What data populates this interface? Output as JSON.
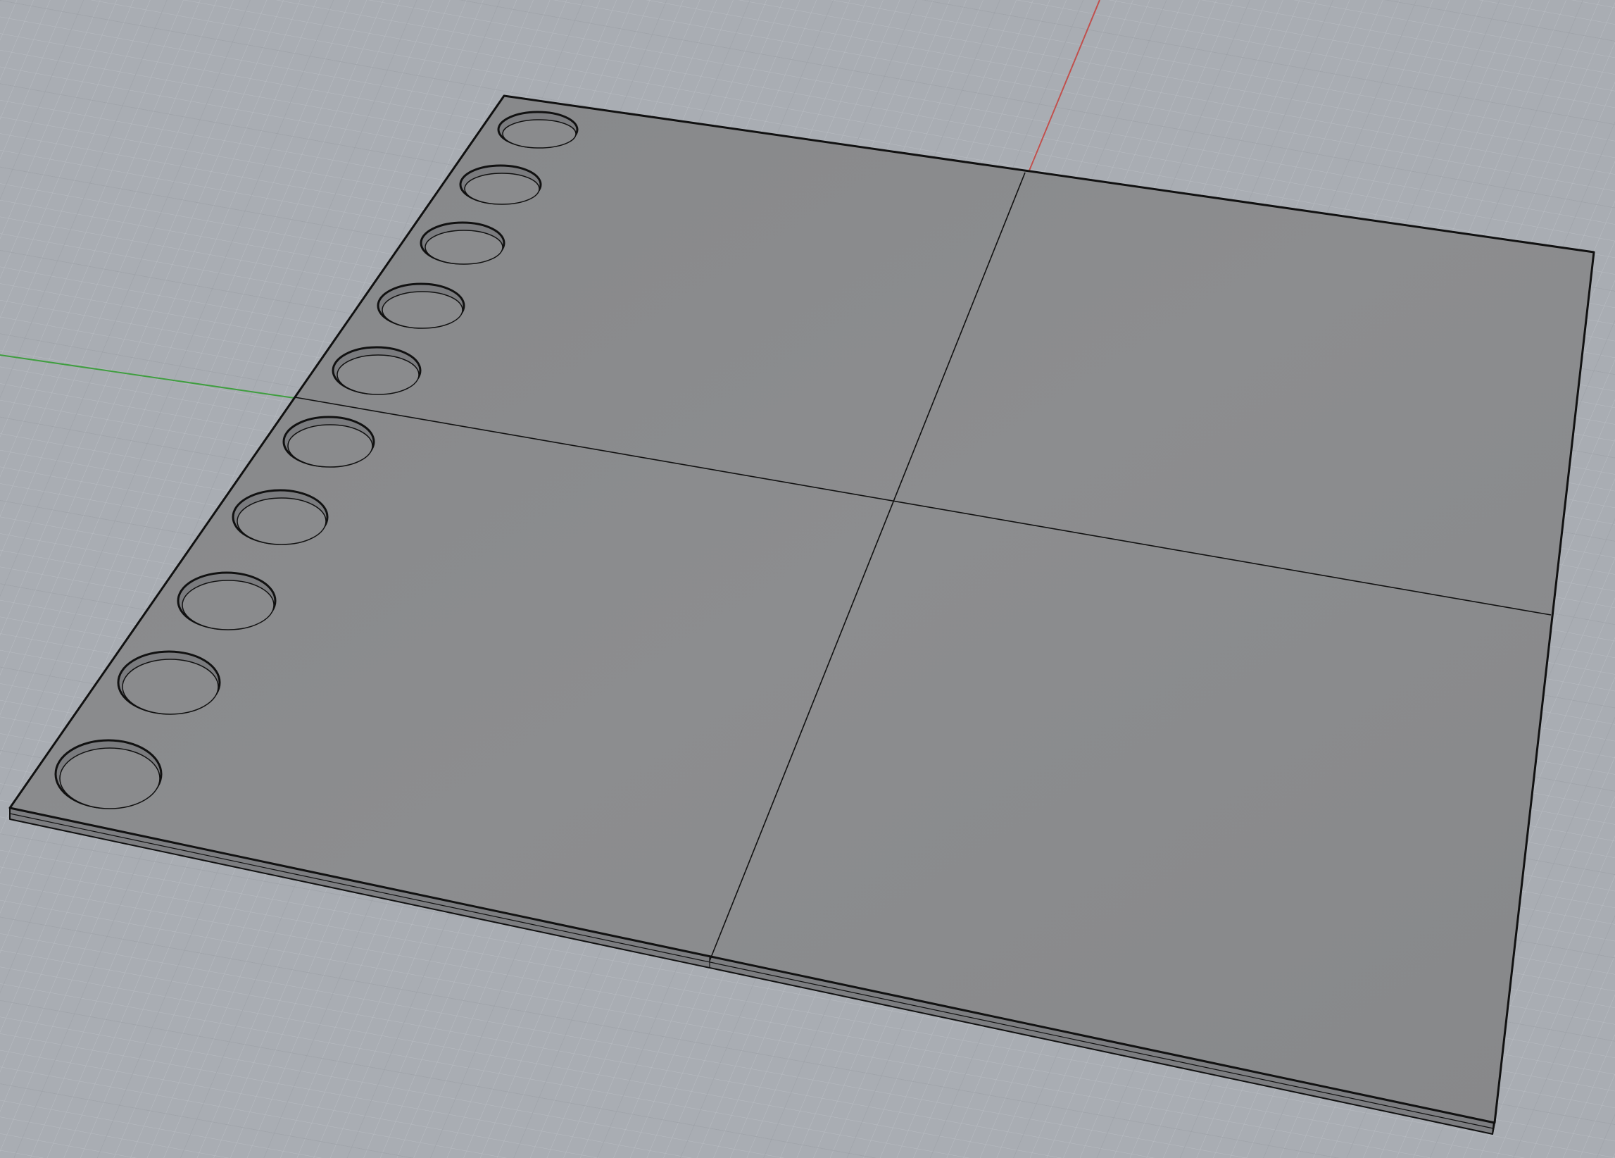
{
  "viewport": {
    "projection": "perspective",
    "background_color": "#a9adb3",
    "grid": {
      "visible": true,
      "minor_line_color": "#b9bdc3",
      "major_line_color": "#9ca0a6"
    },
    "axes": {
      "x_axis_color": "#c0504d",
      "y_axis_color": "#3f9e3f"
    }
  },
  "model": {
    "object": "plate",
    "shading": "shaded",
    "surface_color": "#8a8b8d",
    "edge_color": "#111111",
    "panels": 4,
    "holes": 10
  }
}
